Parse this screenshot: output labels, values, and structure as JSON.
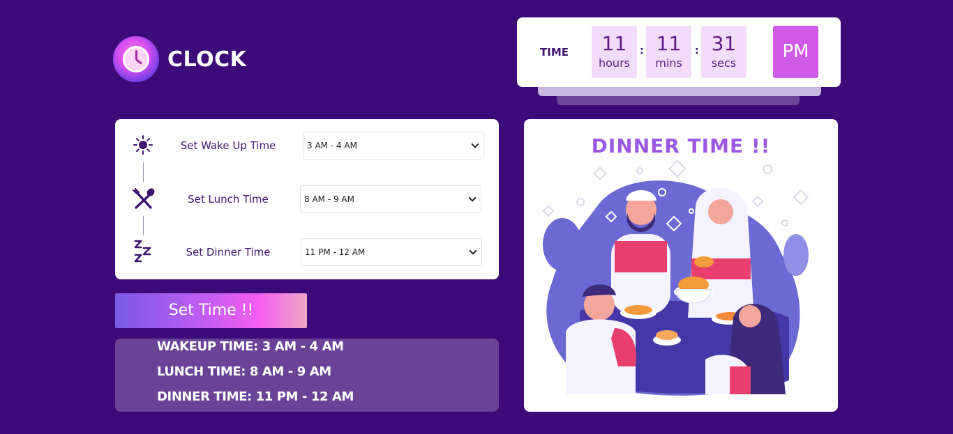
{
  "app": {
    "logo_text": "CLOCK"
  },
  "clock": {
    "label": "TIME",
    "hours": "11",
    "hours_unit": "hours",
    "minutes": "11",
    "minutes_unit": "mins",
    "seconds": "31",
    "seconds_unit": "secs",
    "separator": ":",
    "ampm": "PM"
  },
  "settings": {
    "rows": [
      {
        "label": "Set Wake Up Time",
        "icon": "sun-icon",
        "selected": "3 AM - 4 AM"
      },
      {
        "label": "Set Lunch Time",
        "icon": "fork-spoon-icon",
        "selected": "8 AM - 9 AM"
      },
      {
        "label": "Set Dinner Time",
        "icon": "sleep-zzz-icon",
        "selected": "11 PM - 12 AM"
      }
    ],
    "button_label": "Set Time !!"
  },
  "summary": {
    "wakeup": "WAKEUP TIME: 3 AM - 4 AM",
    "lunch": "LUNCH TIME: 8 AM - 9 AM",
    "dinner": "DINNER TIME: 11 PM - 12 AM"
  },
  "panel": {
    "title": "DINNER TIME !!"
  },
  "colors": {
    "background": "#3d0a7a",
    "accent": "#d05ae8",
    "title": "#9a58e2"
  }
}
